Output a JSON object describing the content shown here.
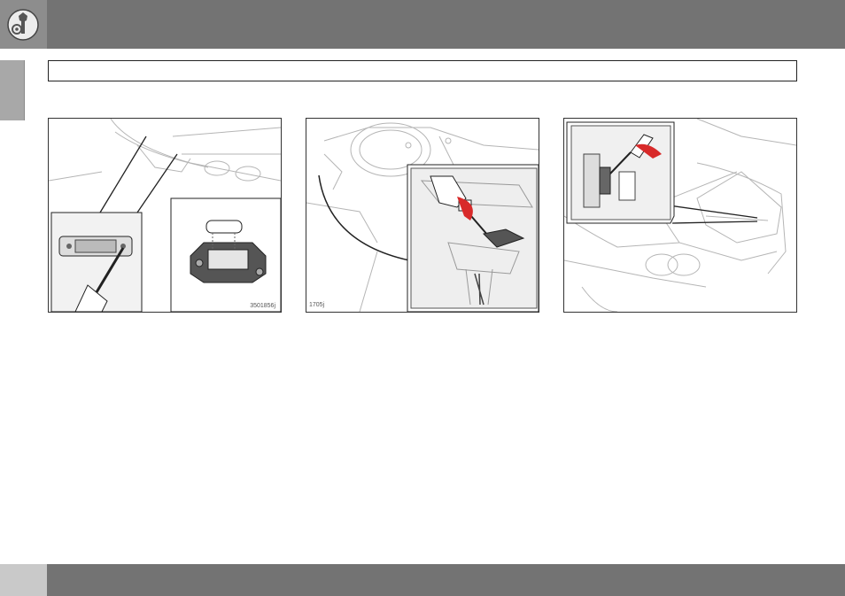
{
  "header": {
    "icon": "wrench-gear-icon"
  },
  "figures": [
    {
      "code": "3501856j"
    },
    {
      "code": "1705j"
    },
    {
      "code": ""
    }
  ],
  "colors": {
    "header_bar": "#737373",
    "side_tab": "#a8a8a8",
    "accent_red": "#d82a2a",
    "footer_page": "#c9c9c9"
  }
}
